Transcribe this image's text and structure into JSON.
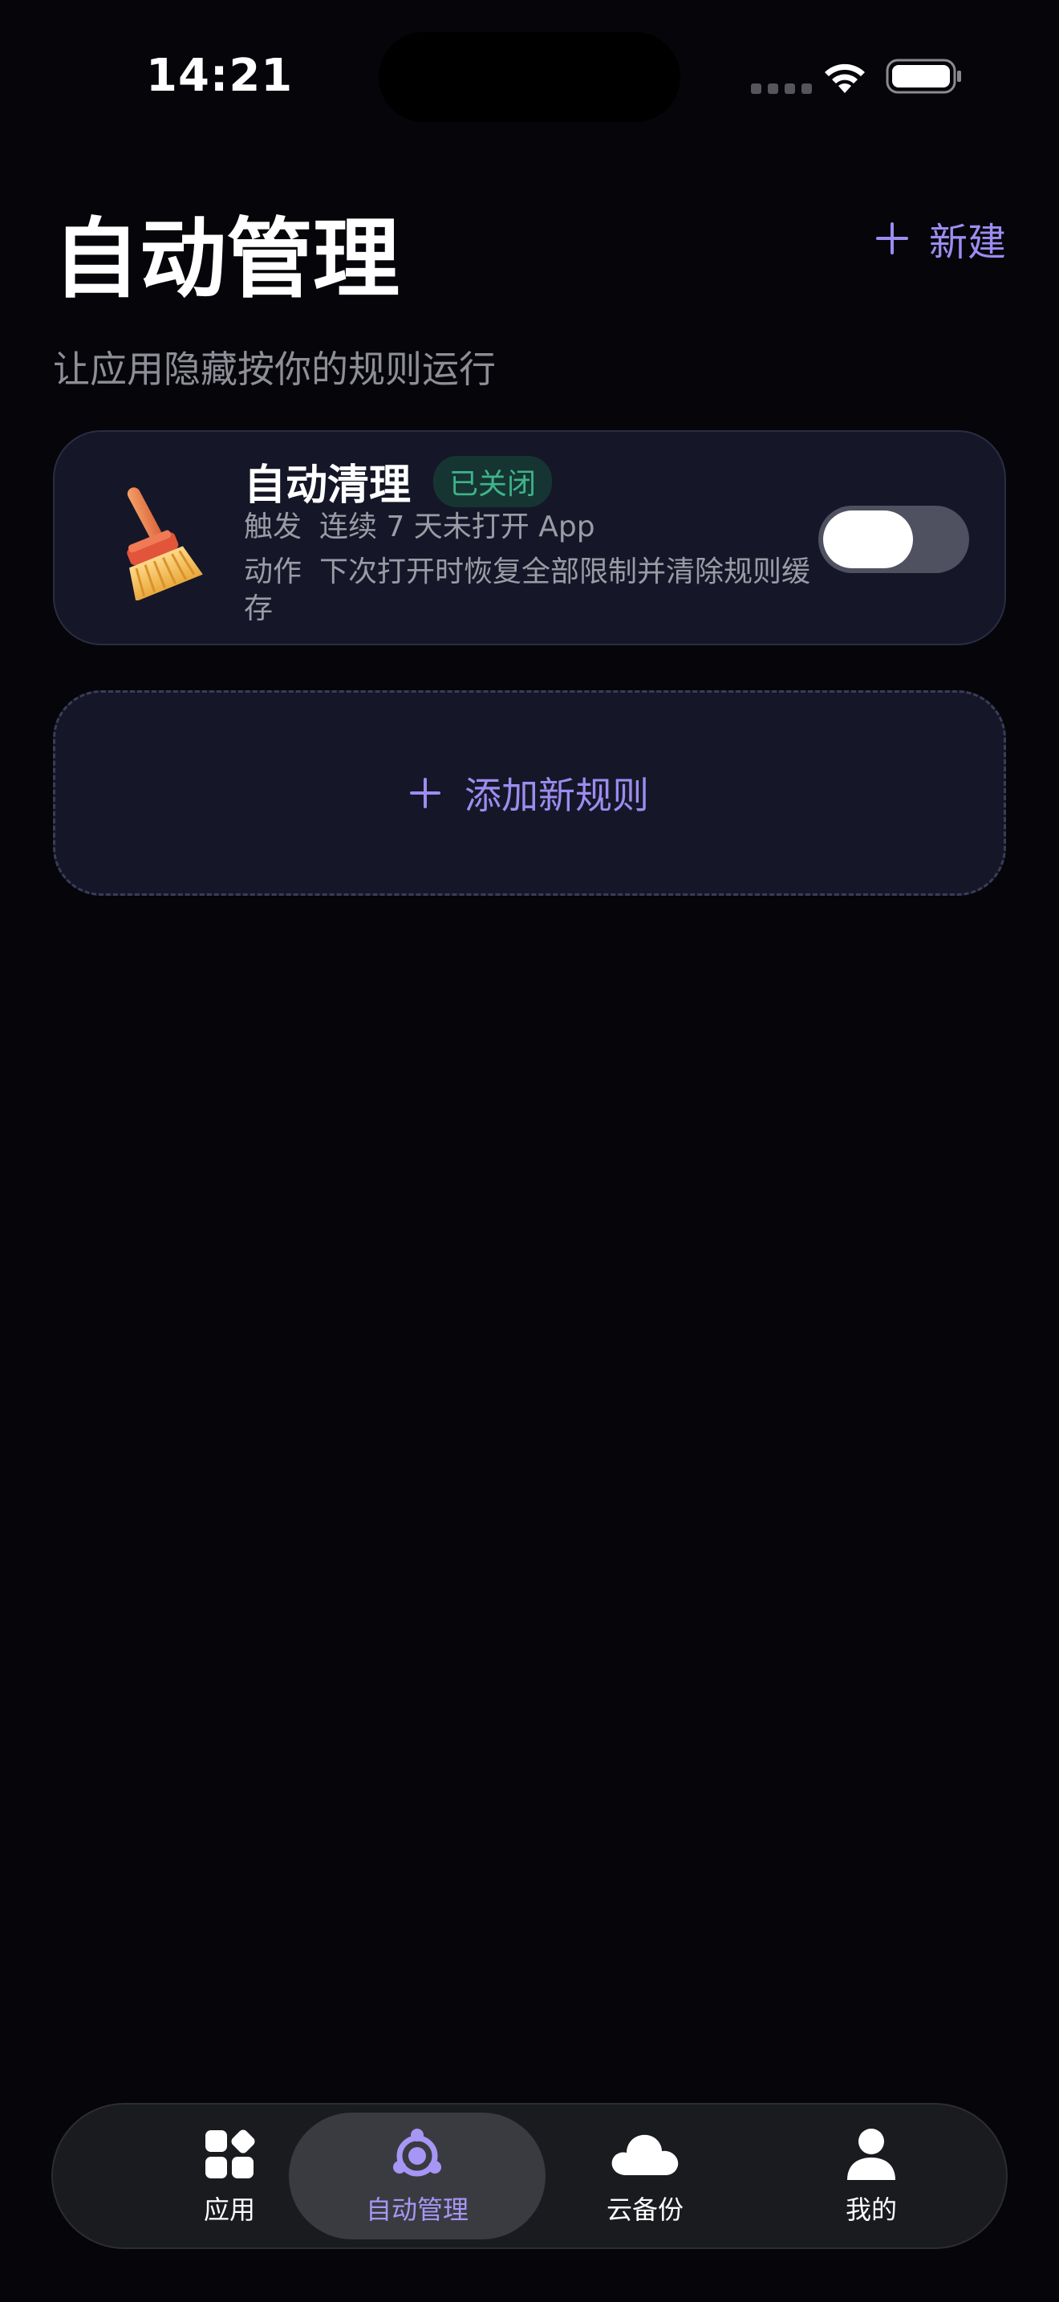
{
  "status_bar": {
    "time": "14:21"
  },
  "header": {
    "title": "自动管理",
    "subtitle": "让应用隐藏按你的规则运行",
    "new_label": "新建"
  },
  "rule": {
    "title": "自动清理",
    "status": "已关闭",
    "trigger_label": "触发",
    "trigger_value": "连续 7 天未打开 App",
    "action_label": "动作",
    "action_value": "下次打开时恢复全部限制并清除规则缓存",
    "enabled": false,
    "icon": "broom-icon"
  },
  "add_rule": {
    "label": "添加新规则"
  },
  "tabs": [
    {
      "label": "应用",
      "icon": "apps-icon",
      "active": false
    },
    {
      "label": "自动管理",
      "icon": "automation-icon",
      "active": true
    },
    {
      "label": "云备份",
      "icon": "cloud-icon",
      "active": false
    },
    {
      "label": "我的",
      "icon": "person-icon",
      "active": false
    }
  ],
  "colors": {
    "background": "#05050a",
    "accent": "#9d8cf0",
    "card": "#151728",
    "status_off_text": "#3fb38a",
    "status_off_bg": "#163532"
  }
}
